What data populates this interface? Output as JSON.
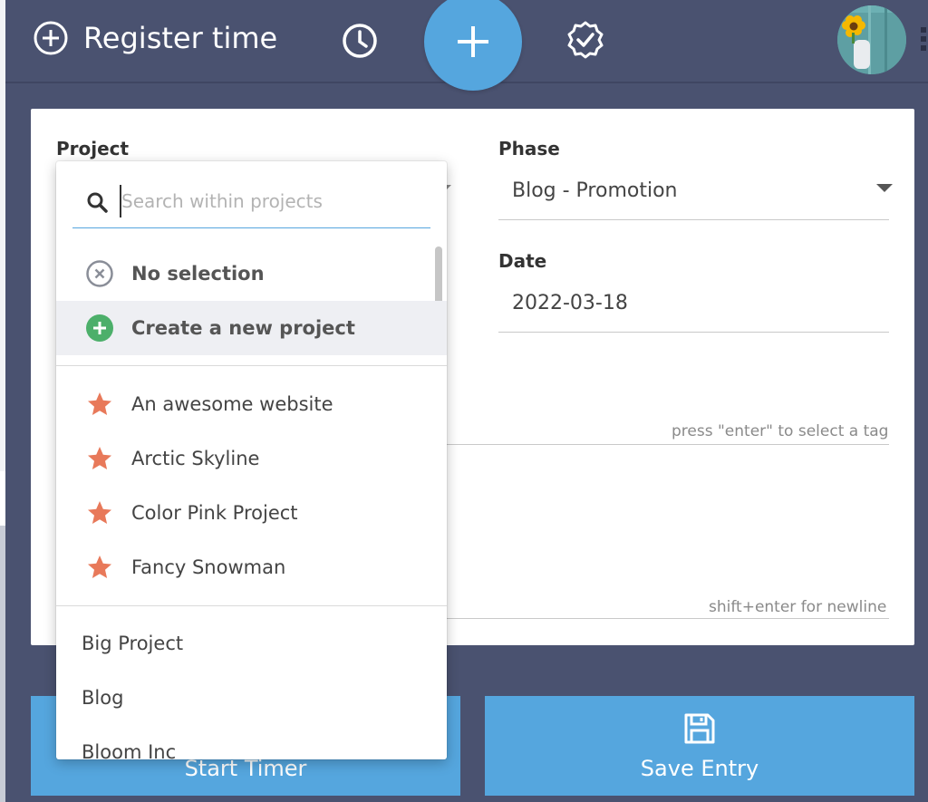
{
  "header": {
    "title": "Register time",
    "icons": {
      "title_icon": "plus-circle-icon",
      "clock": "clock-icon",
      "add": "plus-icon",
      "badge": "badge-check-icon",
      "avatar": "user-avatar",
      "more": "more-icon"
    }
  },
  "form": {
    "project_label": "Project",
    "phase_label": "Phase",
    "phase_value": "Blog - Promotion",
    "date_label": "Date",
    "date_value": "2022-03-18",
    "tags_hint": "press \"enter\" to select a tag",
    "description_hint": "shift+enter for newline"
  },
  "dropdown": {
    "search_placeholder": "Search within projects",
    "search_value": "",
    "no_selection": "No selection",
    "create_new": "Create a new project",
    "favorites": [
      "An awesome website",
      "Arctic Skyline",
      "Color Pink Project",
      "Fancy Snowman"
    ],
    "projects": [
      "Big Project",
      "Blog",
      "Bloom Inc"
    ]
  },
  "actions": {
    "start_timer": "Start Timer",
    "save_entry": "Save Entry"
  },
  "colors": {
    "header_bg": "#4a5270",
    "accent": "#55a6de",
    "star": "#e8795a",
    "create_green": "#4caf6a"
  }
}
